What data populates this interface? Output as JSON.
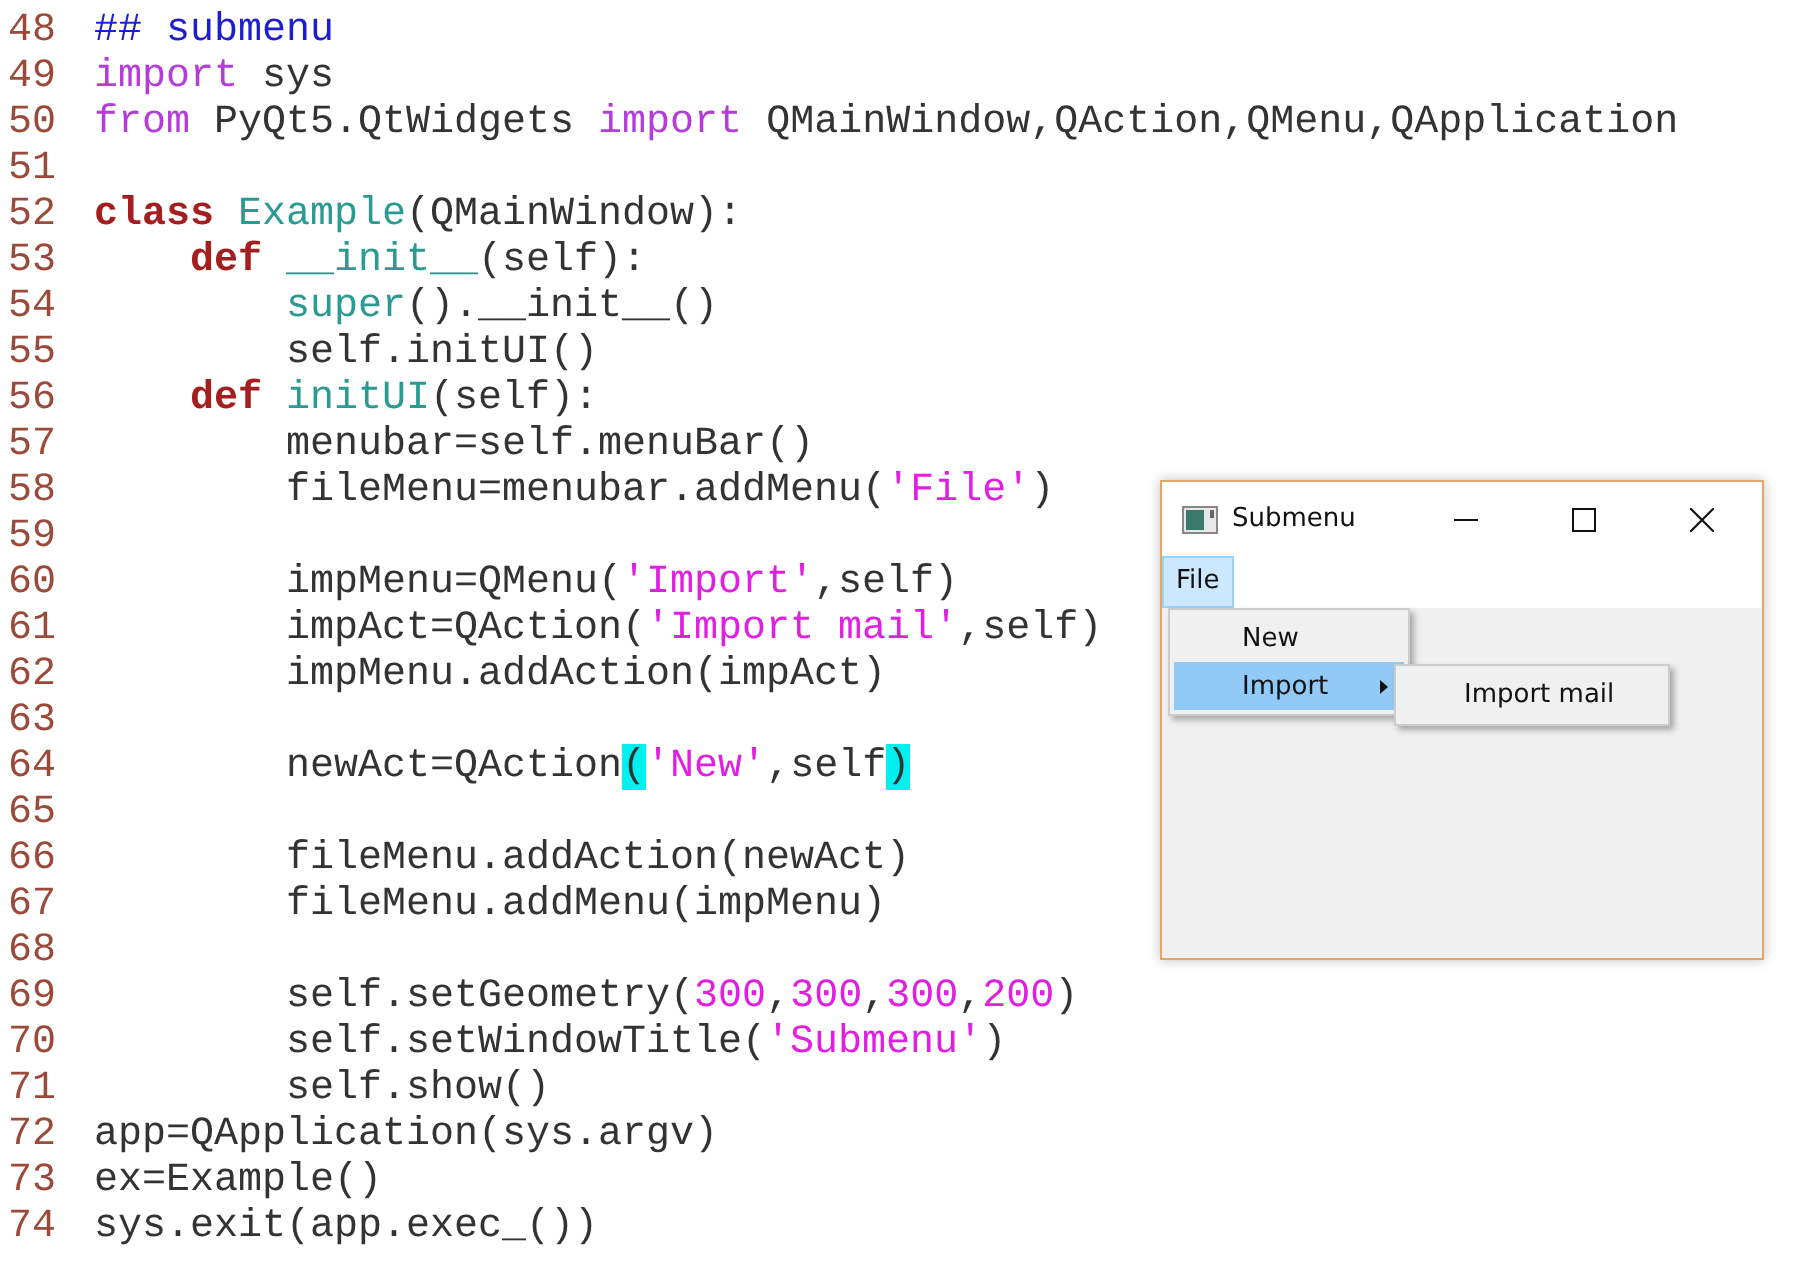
{
  "editor": {
    "lines": [
      {
        "number": "48",
        "tokens": [
          {
            "kind": "comment",
            "text": "## submenu"
          }
        ]
      },
      {
        "number": "49",
        "tokens": [
          {
            "kind": "import",
            "text": "import"
          },
          {
            "kind": "plain",
            "text": " sys"
          }
        ]
      },
      {
        "number": "50",
        "tokens": [
          {
            "kind": "import",
            "text": "from"
          },
          {
            "kind": "plain",
            "text": " PyQt5.QtWidgets"
          },
          {
            "kind": "import",
            "text": " import"
          },
          {
            "kind": "plain",
            "text": " QMainWindow,QAction,QMenu,QApplication"
          }
        ]
      },
      {
        "number": "51"
      },
      {
        "number": "52",
        "tokens": [
          {
            "kind": "keyword",
            "text": "class"
          },
          {
            "kind": "name",
            "text": " Example"
          },
          {
            "kind": "plain",
            "text": "(QMainWindow):"
          }
        ]
      },
      {
        "number": "53",
        "tokens": [
          {
            "kind": "keyword",
            "text": "    def"
          },
          {
            "kind": "name",
            "text": " __init__"
          },
          {
            "kind": "plain",
            "text": "(self):"
          }
        ]
      },
      {
        "number": "54",
        "tokens": [
          {
            "kind": "name",
            "text": "        super"
          },
          {
            "kind": "plain",
            "text": "().__init__()"
          }
        ]
      },
      {
        "number": "55",
        "tokens": [
          {
            "kind": "plain",
            "text": "        self.initUI()"
          }
        ]
      },
      {
        "number": "56",
        "tokens": [
          {
            "kind": "keyword",
            "text": "    def"
          },
          {
            "kind": "name",
            "text": " initUI"
          },
          {
            "kind": "plain",
            "text": "(self):"
          }
        ]
      },
      {
        "number": "57",
        "tokens": [
          {
            "kind": "plain",
            "text": "        menubar=self.menuBar()"
          }
        ]
      },
      {
        "number": "58",
        "tokens": [
          {
            "kind": "plain",
            "text": "        fileMenu=menubar.addMenu("
          },
          {
            "kind": "string",
            "text": "'File'"
          },
          {
            "kind": "plain",
            "text": ")"
          }
        ]
      },
      {
        "number": "59"
      },
      {
        "number": "60",
        "tokens": [
          {
            "kind": "plain",
            "text": "        impMenu=QMenu("
          },
          {
            "kind": "string",
            "text": "'Import'"
          },
          {
            "kind": "plain",
            "text": ",self)"
          }
        ]
      },
      {
        "number": "61",
        "tokens": [
          {
            "kind": "plain",
            "text": "        impAct=QAction("
          },
          {
            "kind": "string",
            "text": "'Import mail'"
          },
          {
            "kind": "plain",
            "text": ",self)"
          }
        ]
      },
      {
        "number": "62",
        "tokens": [
          {
            "kind": "plain",
            "text": "        impMenu.addAction(impAct)"
          }
        ]
      },
      {
        "number": "63"
      },
      {
        "number": "64",
        "tokens": [
          {
            "kind": "plain",
            "text": "        newAct=QAction"
          },
          {
            "kind": "match",
            "text": "("
          },
          {
            "kind": "string",
            "text": "'New'"
          },
          {
            "kind": "plain",
            "text": ",self"
          },
          {
            "kind": "match",
            "text": ")"
          }
        ]
      },
      {
        "number": "65"
      },
      {
        "number": "66",
        "tokens": [
          {
            "kind": "plain",
            "text": "        fileMenu.addAction(newAct)"
          }
        ]
      },
      {
        "number": "67",
        "tokens": [
          {
            "kind": "plain",
            "text": "        fileMenu.addMenu(impMenu)"
          }
        ]
      },
      {
        "number": "68"
      },
      {
        "number": "69",
        "tokens": [
          {
            "kind": "plain",
            "text": "        self.setGeometry("
          },
          {
            "kind": "number",
            "text": "300"
          },
          {
            "kind": "plain",
            "text": ","
          },
          {
            "kind": "number",
            "text": "300"
          },
          {
            "kind": "plain",
            "text": ","
          },
          {
            "kind": "number",
            "text": "300"
          },
          {
            "kind": "plain",
            "text": ","
          },
          {
            "kind": "number",
            "text": "200"
          },
          {
            "kind": "plain",
            "text": ")"
          }
        ]
      },
      {
        "number": "70",
        "tokens": [
          {
            "kind": "plain",
            "text": "        self.setWindowTitle("
          },
          {
            "kind": "string",
            "text": "'Submenu'"
          },
          {
            "kind": "plain",
            "text": ")"
          }
        ]
      },
      {
        "number": "71",
        "tokens": [
          {
            "kind": "plain",
            "text": "        self.show()"
          }
        ]
      },
      {
        "number": "72",
        "tokens": [
          {
            "kind": "plain",
            "text": "app=QApplication(sys.argv)"
          }
        ]
      },
      {
        "number": "73",
        "tokens": [
          {
            "kind": "plain",
            "text": "ex=Example()"
          }
        ]
      },
      {
        "number": "74",
        "tokens": [
          {
            "kind": "plain",
            "text": "sys.exit(app.exec_())"
          }
        ]
      }
    ]
  },
  "window": {
    "title": "Submenu",
    "menubar": [
      {
        "label": "File",
        "selected": true
      }
    ],
    "menu": [
      {
        "label": "New",
        "selected": false,
        "has_submenu": false
      },
      {
        "label": "Import",
        "selected": true,
        "has_submenu": true
      }
    ],
    "submenu": [
      {
        "label": "Import mail",
        "selected": false
      }
    ]
  }
}
